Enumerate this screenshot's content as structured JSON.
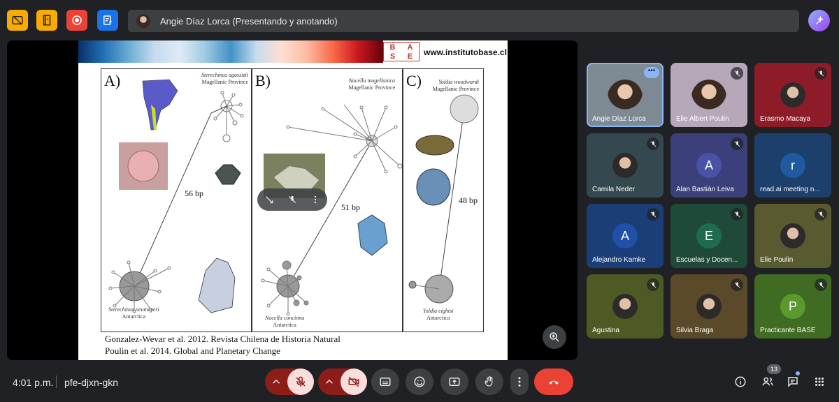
{
  "header": {
    "presenter_text": "Angie Díaz Lorca (Presentando y anotando)"
  },
  "slide": {
    "logo_letters": [
      "B",
      "A",
      "S",
      "E"
    ],
    "url": "www.institutobase.cl",
    "panels": [
      {
        "label": "A)",
        "species": "Sterechinus agassizii",
        "region": "Magellanic Province",
        "bp": "56 bp",
        "bottom_species": "Sterechinus neumayeri",
        "bottom_region": "Antarctica"
      },
      {
        "label": "B)",
        "species": "Nacella magellanica",
        "region": "Magellanic Province",
        "bp": "51 bp",
        "bottom_species": "Nacella concinna",
        "bottom_region": "Antarctica"
      },
      {
        "label": "C)",
        "species": "Yoldia woodwardi",
        "region": "Magellanic Province",
        "bp": "48 bp",
        "bottom_species": "Yoldia eightsi",
        "bottom_region": "Antarctica"
      }
    ],
    "citation_1": "Gonzalez-Wevar et al. 2012. Revista Chilena de Historia Natural",
    "citation_2": "Poulin et al. 2014. Global and Planetary Change"
  },
  "participants": [
    {
      "name": "Angie Díaz Lorca",
      "muted": false,
      "type": "video",
      "bg": "#7d8a94"
    },
    {
      "name": "Elie Albert Poulin",
      "muted": true,
      "type": "video",
      "bg": "#b6a7b9"
    },
    {
      "name": "Erasmo Macaya",
      "muted": true,
      "type": "photo",
      "bg": "#8e1c28"
    },
    {
      "name": "Camila Neder",
      "muted": true,
      "type": "photo",
      "bg": "#33494f"
    },
    {
      "name": "Alan Bastián Leiva",
      "muted": true,
      "type": "initial",
      "initial": "A",
      "bg": "#3b3f7a",
      "avatar_color": "#4a52a8"
    },
    {
      "name": "read.ai meeting n...",
      "muted": false,
      "type": "initial",
      "initial": "r",
      "bg": "#1d3f6b",
      "avatar_color": "#1f5aa0"
    },
    {
      "name": "Alejandro Kamke",
      "muted": true,
      "type": "initial",
      "initial": "A",
      "bg": "#1b3d78",
      "avatar_color": "#2050a8"
    },
    {
      "name": "Escuelas y Docen...",
      "muted": true,
      "type": "initial",
      "initial": "E",
      "bg": "#1f4a3a",
      "avatar_color": "#1f6b4f"
    },
    {
      "name": "Elie Poulin",
      "muted": true,
      "type": "photo",
      "bg": "#5a5a30"
    },
    {
      "name": "Agustina",
      "muted": true,
      "type": "photo",
      "bg": "#4d5a24"
    },
    {
      "name": "Silvia Braga",
      "muted": true,
      "type": "photo",
      "bg": "#5a4a2a"
    },
    {
      "name": "Practicante BASE",
      "muted": true,
      "type": "initial",
      "initial": "P",
      "bg": "#3f6b22",
      "avatar_color": "#5a9a2c"
    }
  ],
  "footer": {
    "time": "4:01 p.m.",
    "meeting_code": "pfe-djxn-gkn",
    "participant_count": "13"
  },
  "colors": {
    "end_call": "#ea4335",
    "muted_ctrl": "#f9dedc",
    "muted_chevron": "#8c1d18",
    "ctrl_bg": "#3c4043"
  }
}
